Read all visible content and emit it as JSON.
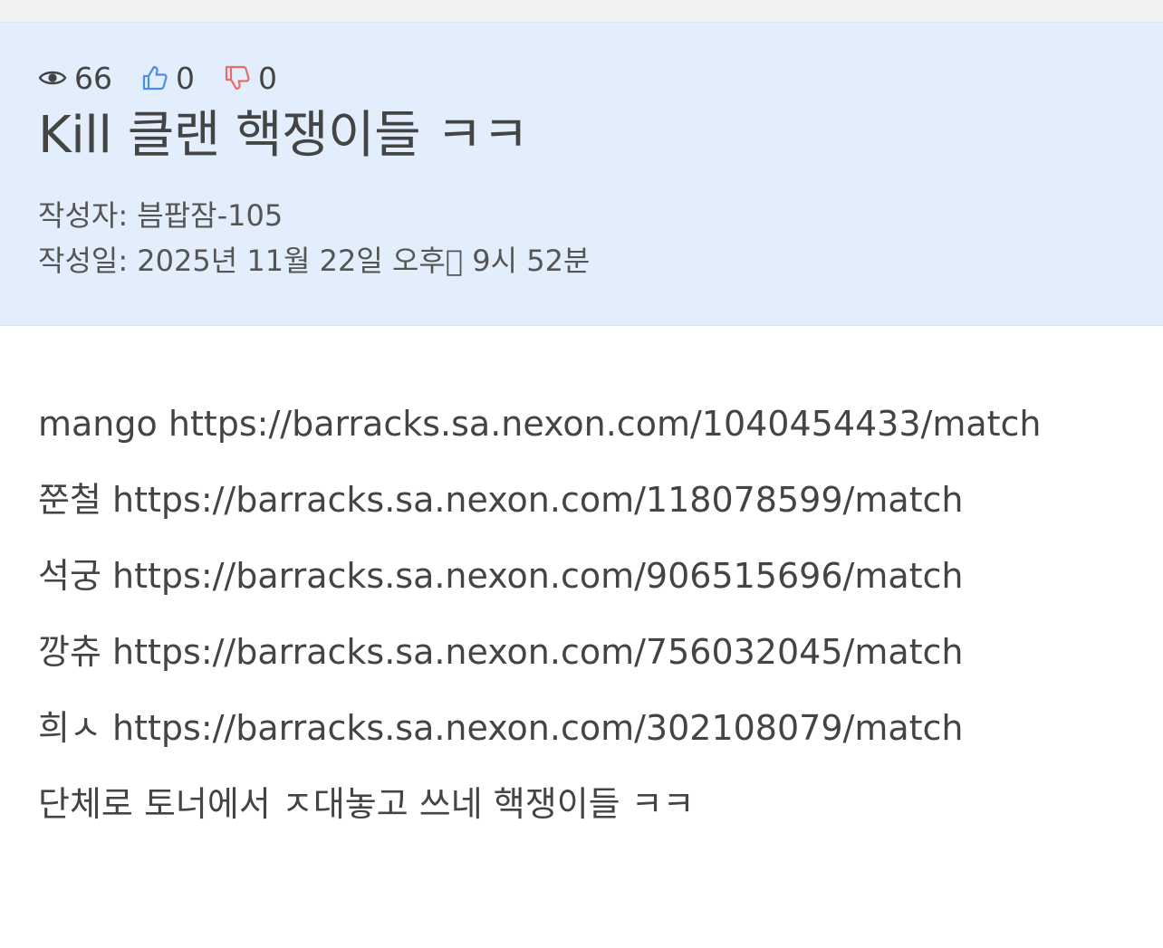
{
  "stats": {
    "views": "66",
    "likes": "0",
    "dislikes": "0"
  },
  "post": {
    "title": "Kill 클랜 핵쟁이들 ㅋㅋ",
    "author_label": "작성자:",
    "author": "븜팝잠-105",
    "date_label": "작성일:",
    "date": "2025년 11월 22일 오후\u0000 9시 52분"
  },
  "content": {
    "lines": [
      {
        "name": "mango",
        "url": "https://barracks.sa.nexon.com/1040454433/match"
      },
      {
        "name": "쭌철",
        "url": "https://barracks.sa.nexon.com/118078599/match"
      },
      {
        "name": "석궁",
        "url": "https://barracks.sa.nexon.com/906515696/match"
      },
      {
        "name": "깡츄",
        "url": "https://barracks.sa.nexon.com/756032045/match"
      },
      {
        "name": "희ㅅ",
        "url": "https://barracks.sa.nexon.com/302108079/match"
      }
    ],
    "closing": "단체로 토너에서 ㅈ대놓고 쓰네 핵쟁이들 ㅋㅋ"
  },
  "colors": {
    "header_bg": "#e2eefb",
    "like": "#4a8fe7",
    "dislike": "#e86b6b"
  }
}
